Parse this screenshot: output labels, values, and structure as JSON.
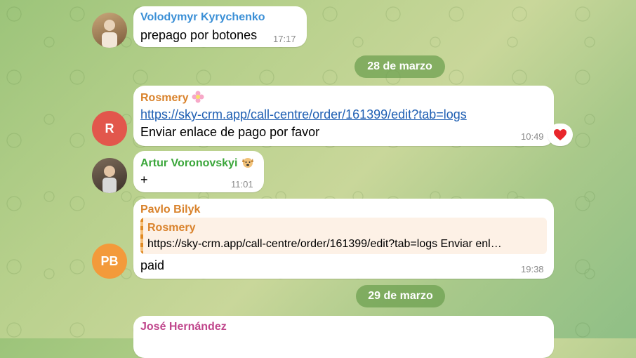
{
  "dates": [
    "28 de marzo",
    "29 de marzo"
  ],
  "messages": [
    {
      "sender": "Volodymyr Kyrychenko",
      "text": "prepago por botones",
      "time": "17:17",
      "name_color": "#3a8fd6"
    },
    {
      "sender": "Rosmery",
      "link": "https://sky-crm.app/call-centre/order/161399/edit?tab=logs",
      "text": "Enviar enlace de pago por favor",
      "time": "10:49",
      "name_color": "#d9822b",
      "avatar_initial": "R",
      "avatar_color": "#e2574c",
      "reaction": "heart-icon"
    },
    {
      "sender": "Artur Voronovskyi",
      "text": "+",
      "time": "11:01",
      "name_color": "#3aa63a"
    },
    {
      "sender": "Pavlo Bilyk",
      "reply_sender": "Rosmery",
      "reply_text": "https://sky-crm.app/call-centre/order/161399/edit?tab=logs Enviar enl…",
      "text": "paid",
      "time": "19:38",
      "name_color": "#d9822b",
      "avatar_initials": "PB",
      "avatar_color": "#f39a3b"
    },
    {
      "sender": "José Hernández",
      "name_color": "#c0468c"
    }
  ]
}
